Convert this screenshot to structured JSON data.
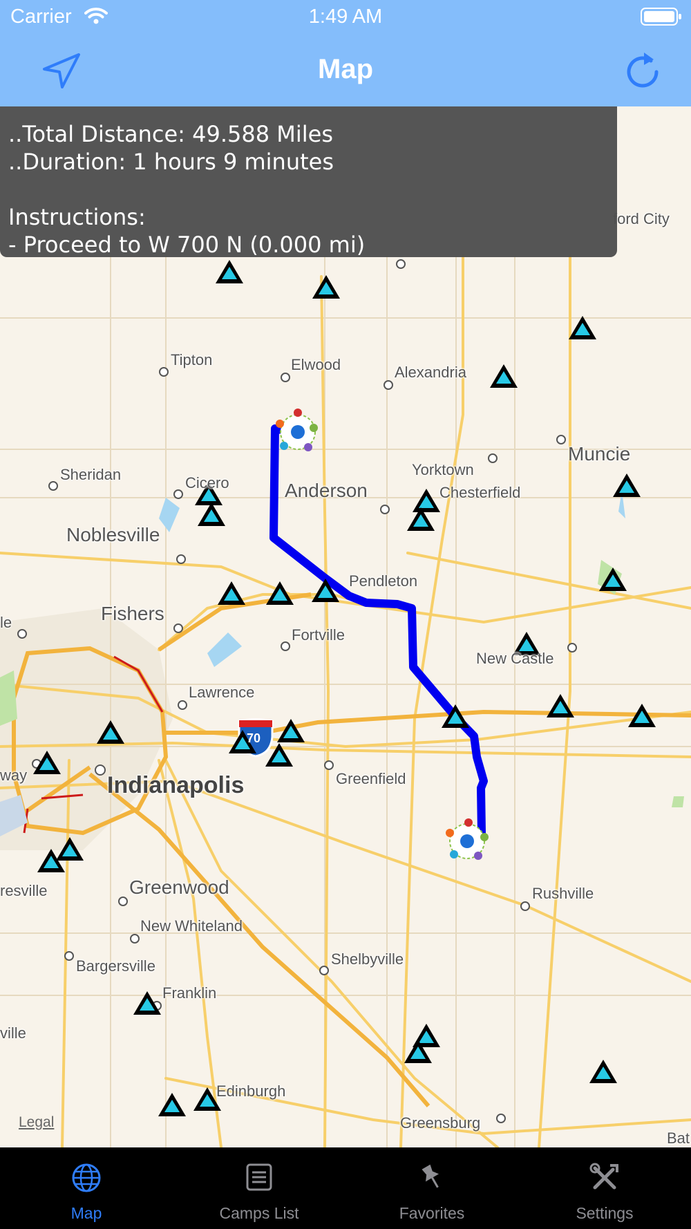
{
  "status_bar": {
    "carrier": "Carrier",
    "time": "1:49 AM",
    "wifi_icon": "wifi-icon",
    "battery_icon": "battery-icon"
  },
  "nav_bar": {
    "title": "Map",
    "left_icon": "location-arrow-icon",
    "right_icon": "refresh-icon",
    "background": "#84bdfb"
  },
  "route_info": {
    "total_distance": "..Total Distance: 49.588 Miles",
    "duration": "..Duration: 1 hours 9 minutes",
    "instructions_title": "Instructions:",
    "instruction_1": "- Proceed to W 700 N (0.000 mi)"
  },
  "map": {
    "route_color": "#0000f0",
    "places": {
      "ford_city": "ford City",
      "tipton": "Tipton",
      "elwood": "Elwood",
      "alexandria": "Alexandria",
      "muncie": "Muncie",
      "yorktown": "Yorktown",
      "sheridan": "Sheridan",
      "cicero": "Cicero",
      "anderson": "Anderson",
      "chesterfield": "Chesterfield",
      "noblesville": "Noblesville",
      "pendleton": "Pendleton",
      "fishers": "Fishers",
      "le": "le",
      "fortville": "Fortville",
      "new_castle": "New Castle",
      "lawrence": "Lawrence",
      "way": "way",
      "indianapolis": "Indianapolis",
      "greenfield": "Greenfield",
      "resville": "resville",
      "greenwood": "Greenwood",
      "rushville": "Rushville",
      "new_whiteland": "New Whiteland",
      "bargersville": "Bargersville",
      "shelbyville": "Shelbyville",
      "franklin": "Franklin",
      "ville": "ville",
      "edinburgh": "Edinburgh",
      "greensburg": "Greensburg",
      "bat": "Bat"
    },
    "interstate_shield": "70",
    "legal": "Legal",
    "camp_icon": "campsite-triangle-icon"
  },
  "tab_bar": {
    "tabs": [
      {
        "label": "Map",
        "icon": "globe-icon",
        "active": true
      },
      {
        "label": "Camps List",
        "icon": "list-icon",
        "active": false
      },
      {
        "label": "Favorites",
        "icon": "pin-icon",
        "active": false
      },
      {
        "label": "Settings",
        "icon": "tools-icon",
        "active": false
      }
    ],
    "active_color": "#2f7dfa",
    "inactive_color": "#8e8e93"
  }
}
